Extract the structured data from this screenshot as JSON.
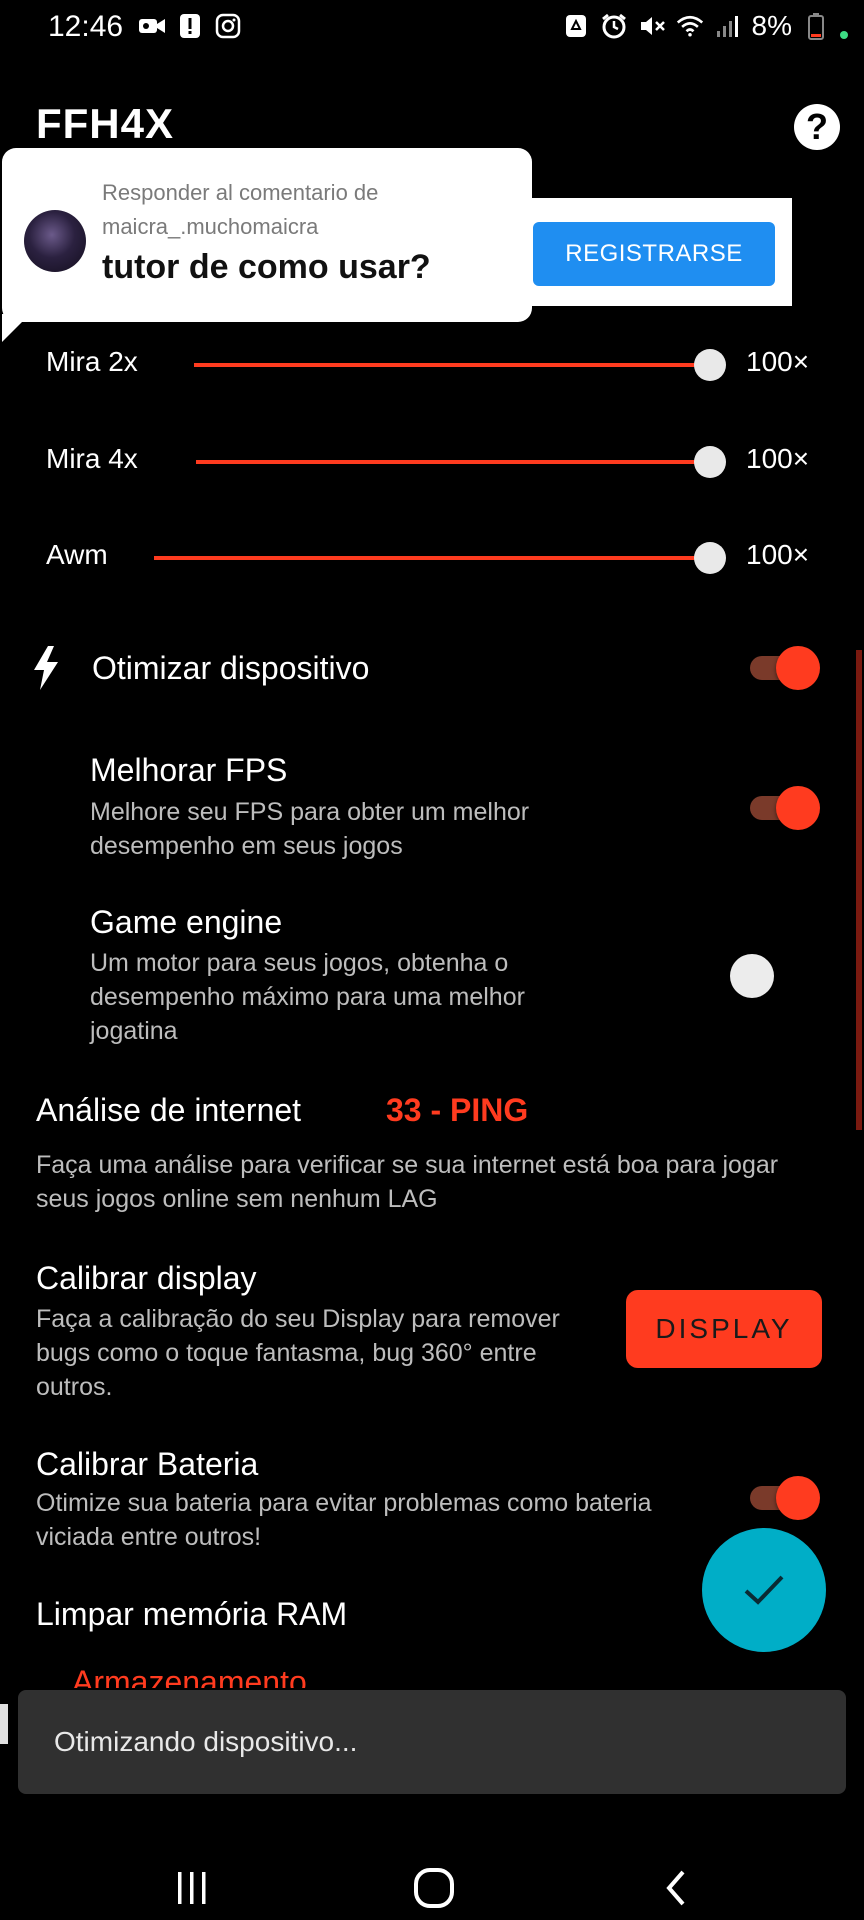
{
  "status_bar": {
    "time": "12:46",
    "battery_percent": "8%",
    "left_icons": [
      "video-icon",
      "alert-icon",
      "instagram-icon"
    ],
    "right_icons": [
      "recycle-icon",
      "alarm-icon",
      "mute-icon",
      "wifi-icon",
      "signal-icon",
      "battery-icon"
    ]
  },
  "header": {
    "title": "FFH4X",
    "help_icon": "help-icon"
  },
  "comment_overlay": {
    "reply_label": "Responder al comentario de maicra_.muchomaicra",
    "comment_text": "tutor de como usar?",
    "register_label": "REGISTRARSE",
    "register_color": "#1f8ef1"
  },
  "sliders": [
    {
      "label": "Mira 2x",
      "value_text": "100×",
      "fill": 1.0
    },
    {
      "label": "Mira 4x",
      "value_text": "100×",
      "fill": 1.0
    },
    {
      "label": "Awm",
      "value_text": "100×",
      "fill": 1.0
    }
  ],
  "optimize": {
    "icon": "bolt-icon",
    "title": "Otimizar dispositivo",
    "enabled": true
  },
  "fps": {
    "title": "Melhorar FPS",
    "desc": "Melhore seu FPS para obter um melhor desempenho em seus jogos",
    "enabled": true
  },
  "game_engine": {
    "title": "Game engine",
    "desc": "Um motor para seus jogos, obtenha o desempenho máximo para uma melhor jogatina",
    "enabled": false
  },
  "internet": {
    "title": "Análise de internet",
    "ping": "33 - PING",
    "desc": "Faça uma análise para verificar se sua internet está boa para jogar seus jogos online sem nenhum LAG"
  },
  "display": {
    "title": "Calibrar display",
    "desc": "Faça a calibração do seu Display para remover bugs como o toque fantasma, bug 360° entre outros.",
    "button": "DISPLAY"
  },
  "battery": {
    "title": "Calibrar Bateria",
    "desc": "Otimize sua bateria para evitar problemas como bateria viciada entre outros!",
    "enabled": true
  },
  "ram": {
    "title": "Limpar memória RAM"
  },
  "storage_partial": "Armazenamento",
  "fab_icon": "check-icon",
  "snackbar": "Otimizando dispositivo...",
  "accent_color": "#ff3b1f",
  "nav": [
    "recents-icon",
    "home-icon",
    "back-icon"
  ]
}
